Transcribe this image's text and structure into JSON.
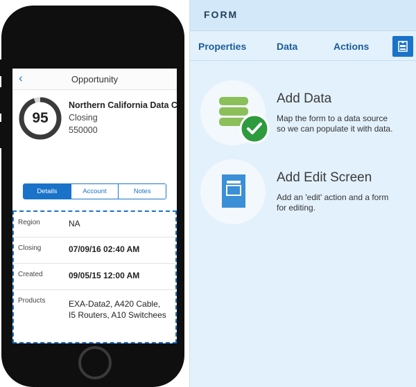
{
  "phone": {
    "nav": {
      "back_glyph": "‹",
      "title": "Opportunity"
    },
    "record": {
      "score": "95",
      "score_percent": 95,
      "name": "Northern California Data C",
      "stage": "Closing",
      "amount": "550000"
    },
    "segments": [
      "Details",
      "Account",
      "Notes"
    ],
    "active_segment": "Details",
    "fields": [
      {
        "label": "Region",
        "value": "NA"
      },
      {
        "label": "Closing",
        "value": "07/09/16 02:40 AM"
      },
      {
        "label": "Created",
        "value": "09/05/15 12:00 AM"
      },
      {
        "label": "Products",
        "value_line1": "EXA-Data2, A420 Cable,",
        "value_line2": "I5 Routers, A10 Switchees"
      }
    ]
  },
  "panel": {
    "title": "FORM",
    "tabs": [
      "Properties",
      "Data",
      "Actions"
    ],
    "tab_icon": "form-layout-icon",
    "cards": [
      {
        "title": "Add Data",
        "desc_line1": "Map the form to a data source",
        "desc_line2": "so we can populate it with data.",
        "icon": "database-icon",
        "badge_icon": "checkmark-icon"
      },
      {
        "title": "Add Edit Screen",
        "desc_line1": "Add an 'edit' action and a form",
        "desc_line2": "for editing.",
        "icon": "edit-screen-icon"
      }
    ]
  },
  "colors": {
    "accent": "#1a73c9",
    "panel_bg": "#e3f1fc",
    "panel_header": "#d3e8f8",
    "db_green": "#8bbf5a",
    "check_green": "#2e9b3e"
  }
}
